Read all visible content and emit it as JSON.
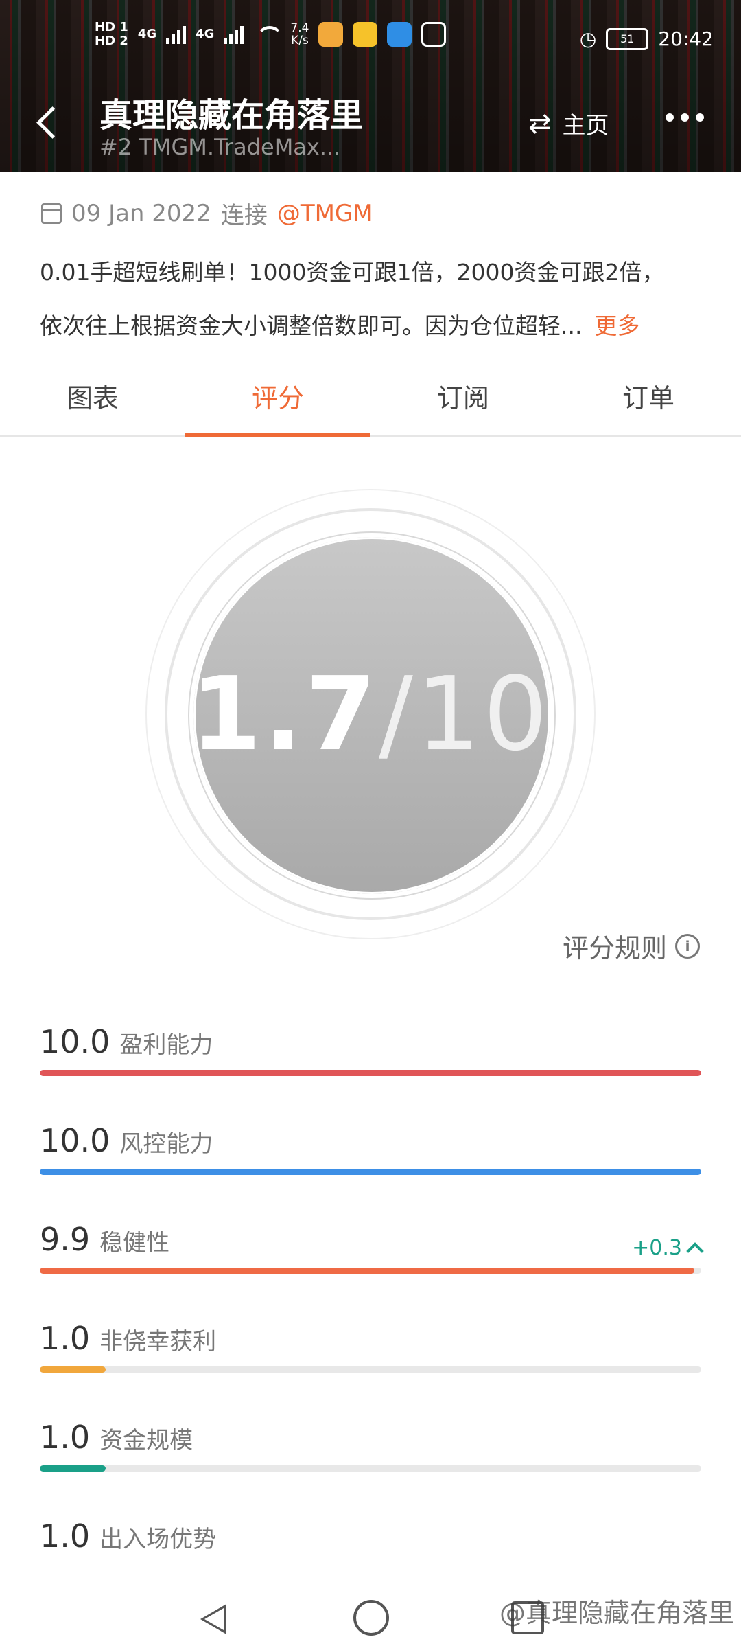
{
  "status_bar": {
    "sim1": "HD 1",
    "sim2": "HD 2",
    "net1": "4G",
    "net2": "4G",
    "speed": "7.4",
    "speed_unit": "K/s",
    "battery": "51",
    "time": "20:42"
  },
  "header": {
    "title": "真理隐藏在角落里",
    "subtitle": "#2  TMGM.TradeMax...",
    "home_label": "主页"
  },
  "info": {
    "date": "09 Jan 2022",
    "connect_label": "连接",
    "broker_handle": "@TMGM",
    "description_line1": "0.01手超短线刷单！1000资金可跟1倍，2000资金可跟2倍，",
    "description_line2": "依次往上根据资金大小调整倍数即可。因为仓位超轻...",
    "more_label": "更多"
  },
  "tabs": [
    {
      "label": "图表",
      "active": false
    },
    {
      "label": "评分",
      "active": true
    },
    {
      "label": "订阅",
      "active": false
    },
    {
      "label": "订单",
      "active": false
    }
  ],
  "score": {
    "value": "1.7",
    "denominator": "/10",
    "rules_label": "评分规则"
  },
  "metrics": [
    {
      "value": "10.0",
      "name": "盈利能力",
      "fill": 1.0,
      "color": "#e05557"
    },
    {
      "value": "10.0",
      "name": "风控能力",
      "fill": 1.0,
      "color": "#3d8fe6"
    },
    {
      "value": "9.9",
      "name": "稳健性",
      "fill": 0.99,
      "color": "#ef6a45",
      "delta": "+0.3"
    },
    {
      "value": "1.0",
      "name": "非侥幸获利",
      "fill": 0.1,
      "color": "#f1a73c"
    },
    {
      "value": "1.0",
      "name": "资金规模",
      "fill": 0.1,
      "color": "#1aa088"
    },
    {
      "value": "1.0",
      "name": "出入场优势",
      "fill": 0.1,
      "color": "#8e6fd6"
    }
  ],
  "watermark": "@真理隐藏在角落里",
  "colors": {
    "accent": "#ef6a36",
    "positive": "#1aa088"
  }
}
